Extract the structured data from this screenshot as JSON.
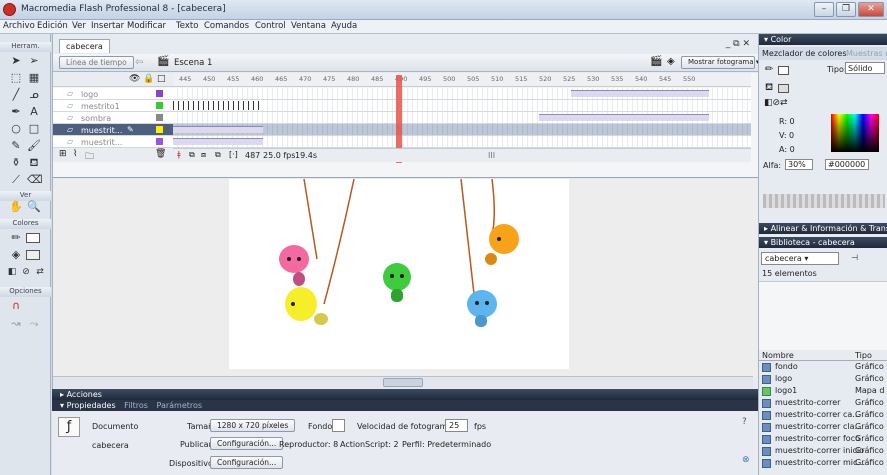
{
  "title": "Macromedia Flash Professional 8 - [cabecera]",
  "menu": [
    "Archivo",
    "Edición",
    "Ver",
    "Insertar",
    "Modificar",
    "Texto",
    "Comandos",
    "Control",
    "Ventana",
    "Ayuda"
  ],
  "tools": {
    "header": "Herram.",
    "view_label": "Ver",
    "colors_label": "Colores",
    "options_label": "Opciones"
  },
  "doc": {
    "tab": "cabecera",
    "timeline_button": "Línea de tiempo",
    "scene": "Escena 1",
    "show_frame": "Mostrar fotograma",
    "ruler": [
      "445",
      "450",
      "455",
      "460",
      "465",
      "470",
      "475",
      "480",
      "485",
      "490",
      "495",
      "500",
      "505",
      "510",
      "515",
      "520",
      "525",
      "530",
      "535",
      "540",
      "545",
      "550"
    ],
    "layers": [
      "logo",
      "mestrito1",
      "sombra",
      "muestrit...",
      "muestrit..."
    ],
    "status": {
      "frame": "487",
      "fps": "25.0 fps",
      "time": "19.4s"
    },
    "scroll_mark": "III"
  },
  "props": {
    "tabs": [
      "Acciones",
      "Propiedades",
      "Filtros",
      "Parámetros"
    ],
    "doc_label": "Documento",
    "doc_name": "cabecera",
    "size_label": "Tamaño:",
    "size_value": "1280 x 720 píxeles",
    "bg_label": "Fondo:",
    "fps_label": "Velocidad de fotogramas:",
    "fps_value": "25",
    "fps_unit": "fps",
    "publish_label": "Publicar:",
    "config": "Configuración...",
    "player": "Reproductor: 8",
    "actionscript": "ActionScript: 2",
    "profile": "Perfil: Predeterminado",
    "device_label": "Dispositivo:"
  },
  "color": {
    "header": "Color",
    "mixer_tab": "Mezclador de colores",
    "swatches_tab": "Muestras de c",
    "type_label": "Tipo:",
    "type_value": "Sólido",
    "r": "R: 0",
    "g": "V: 0",
    "b": "A: 0",
    "alpha_label": "Alfa:",
    "alpha_value": "30%",
    "hex": "#000000"
  },
  "align_header": "Alinear & Información & Transfor",
  "library": {
    "header": "Biblioteca - cabecera",
    "selected": "cabecera",
    "count": "15 elementos",
    "col_name": "Nombre",
    "col_type": "Tipo",
    "items": [
      {
        "name": "fondo",
        "type": "Gráfico"
      },
      {
        "name": "logo",
        "type": "Gráfico"
      },
      {
        "name": "logo1",
        "type": "Mapa d"
      },
      {
        "name": "muestrito-correr",
        "type": "Gráfico"
      },
      {
        "name": "muestrito-correr ca...",
        "type": "Gráfico"
      },
      {
        "name": "muestrito-correr cla...",
        "type": "Gráfico"
      },
      {
        "name": "muestrito-correr foco",
        "type": "Gráfico"
      },
      {
        "name": "muestrito-correr inicio",
        "type": "Gráfico"
      },
      {
        "name": "muestrito-correr mic...",
        "type": "Gráfico"
      }
    ]
  }
}
